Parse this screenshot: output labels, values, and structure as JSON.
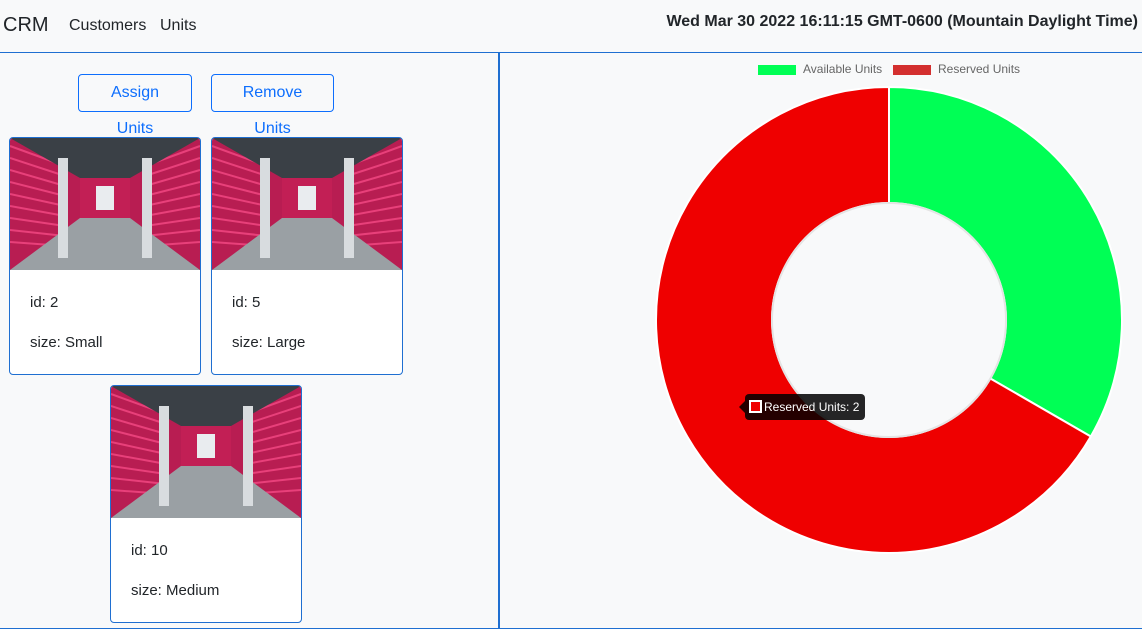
{
  "navbar": {
    "brand": "CRM",
    "links": [
      "Customers",
      "Units"
    ],
    "clock": "Wed Mar 30 2022 16:11:15 GMT-0600 (Mountain Daylight Time)"
  },
  "actions": {
    "assign_label": "Assign Units",
    "remove_label": "Remove Units"
  },
  "units": [
    {
      "id": "id: 2",
      "size": "size: Small"
    },
    {
      "id": "id: 5",
      "size": "size: Large"
    },
    {
      "id": "id: 10",
      "size": "size: Medium"
    }
  ],
  "tooltip": {
    "text": "Reserved Units: 2",
    "color": "#ef0000"
  },
  "chart_data": {
    "type": "pie",
    "variant": "doughnut",
    "labels": [
      "Available Units",
      "Reserved Units"
    ],
    "values": [
      1,
      2
    ],
    "colors": [
      "#00ff55",
      "#ef0000"
    ],
    "legend_colors": [
      "#00ff55",
      "#d32f2f"
    ],
    "legend_position": "top"
  }
}
